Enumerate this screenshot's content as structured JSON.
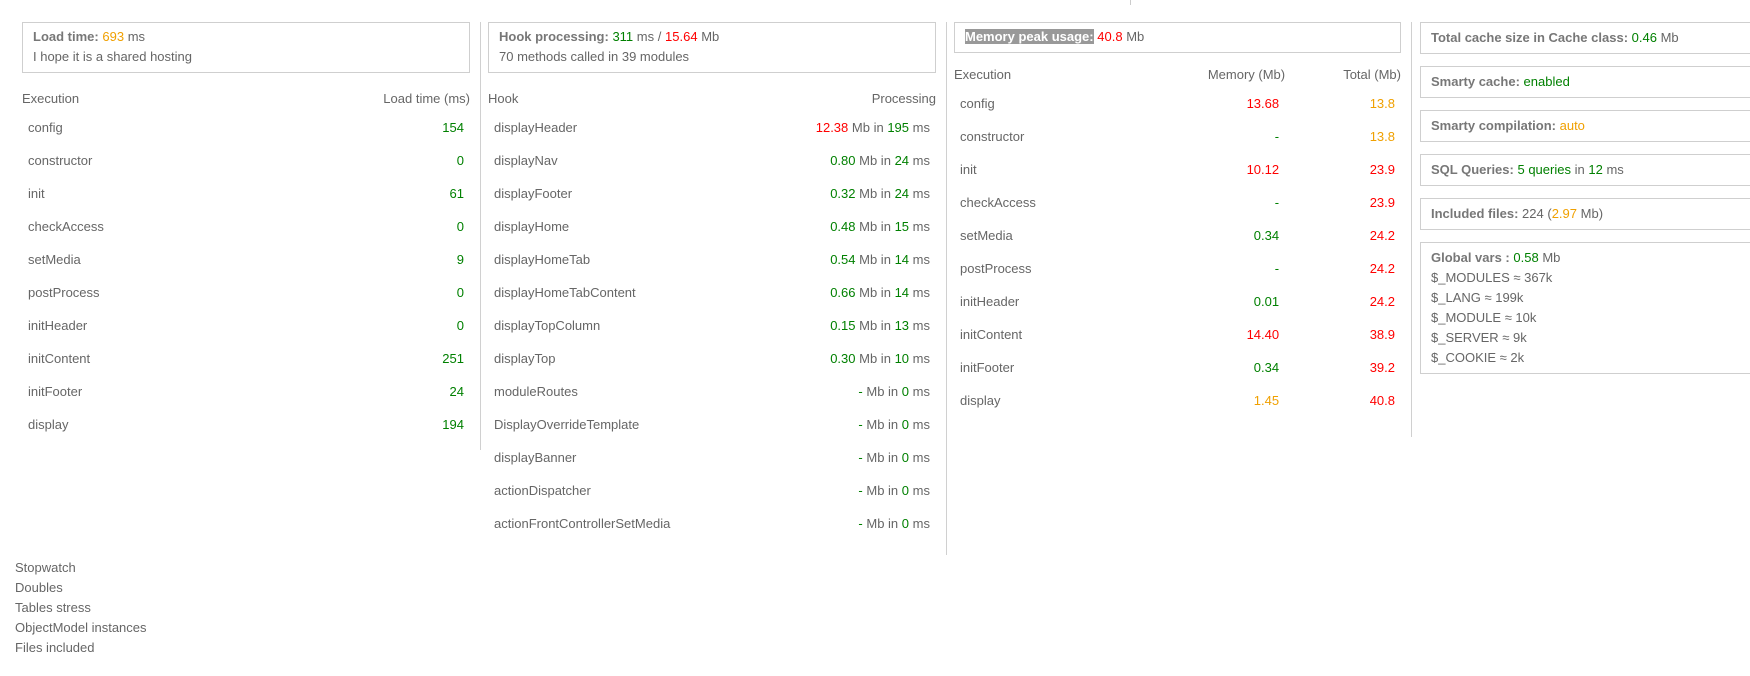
{
  "load": {
    "label": "Load time",
    "value": "693",
    "unit": "ms",
    "comment": "I hope it is a shared hosting",
    "table": {
      "headers": [
        "Execution",
        "Load time (ms)"
      ],
      "rows": [
        {
          "name": "config",
          "value": "154"
        },
        {
          "name": "constructor",
          "value": "0"
        },
        {
          "name": "init",
          "value": "61"
        },
        {
          "name": "checkAccess",
          "value": "0"
        },
        {
          "name": "setMedia",
          "value": "9"
        },
        {
          "name": "postProcess",
          "value": "0"
        },
        {
          "name": "initHeader",
          "value": "0"
        },
        {
          "name": "initContent",
          "value": "251"
        },
        {
          "name": "initFooter",
          "value": "24"
        },
        {
          "name": "display",
          "value": "194"
        }
      ]
    }
  },
  "hooks": {
    "label": "Hook processing",
    "time": "311",
    "time_unit": "ms",
    "sep": "/",
    "mem": "15.64",
    "mem_unit": "Mb",
    "summary": "70 methods called in 39 modules",
    "table": {
      "headers": [
        "Hook",
        "Processing"
      ],
      "mb_label": "Mb in",
      "ms_label": "ms",
      "rows": [
        {
          "name": "displayHeader",
          "mb": "12.38",
          "mb_color": "r",
          "ms": "195"
        },
        {
          "name": "displayNav",
          "mb": "0.80",
          "mb_color": "g",
          "ms": "24"
        },
        {
          "name": "displayFooter",
          "mb": "0.32",
          "mb_color": "g",
          "ms": "24"
        },
        {
          "name": "displayHome",
          "mb": "0.48",
          "mb_color": "g",
          "ms": "15"
        },
        {
          "name": "displayHomeTab",
          "mb": "0.54",
          "mb_color": "g",
          "ms": "14"
        },
        {
          "name": "displayHomeTabContent",
          "mb": "0.66",
          "mb_color": "g",
          "ms": "14"
        },
        {
          "name": "displayTopColumn",
          "mb": "0.15",
          "mb_color": "g",
          "ms": "13"
        },
        {
          "name": "displayTop",
          "mb": "0.30",
          "mb_color": "g",
          "ms": "10"
        },
        {
          "name": "moduleRoutes",
          "mb": "-",
          "mb_color": "g",
          "ms": "0"
        },
        {
          "name": "DisplayOverrideTemplate",
          "mb": "-",
          "mb_color": "g",
          "ms": "0"
        },
        {
          "name": "displayBanner",
          "mb": "-",
          "mb_color": "g",
          "ms": "0"
        },
        {
          "name": "actionDispatcher",
          "mb": "-",
          "mb_color": "g",
          "ms": "0"
        },
        {
          "name": "actionFrontControllerSetMedia",
          "mb": "-",
          "mb_color": "g",
          "ms": "0"
        }
      ]
    }
  },
  "memory": {
    "label": "Memory peak usage",
    "value": "40.8",
    "unit": "Mb",
    "table": {
      "headers": [
        "Execution",
        "Memory (Mb)",
        "Total (Mb)"
      ],
      "rows": [
        {
          "name": "config",
          "mem": "13.68",
          "mem_color": "r",
          "total": "13.8",
          "total_color": "o"
        },
        {
          "name": "constructor",
          "mem": "-",
          "mem_color": "g",
          "total": "13.8",
          "total_color": "o"
        },
        {
          "name": "init",
          "mem": "10.12",
          "mem_color": "r",
          "total": "23.9",
          "total_color": "r"
        },
        {
          "name": "checkAccess",
          "mem": "-",
          "mem_color": "g",
          "total": "23.9",
          "total_color": "r"
        },
        {
          "name": "setMedia",
          "mem": "0.34",
          "mem_color": "g",
          "total": "24.2",
          "total_color": "r"
        },
        {
          "name": "postProcess",
          "mem": "-",
          "mem_color": "g",
          "total": "24.2",
          "total_color": "r"
        },
        {
          "name": "initHeader",
          "mem": "0.01",
          "mem_color": "g",
          "total": "24.2",
          "total_color": "r"
        },
        {
          "name": "initContent",
          "mem": "14.40",
          "mem_color": "r",
          "total": "38.9",
          "total_color": "r"
        },
        {
          "name": "initFooter",
          "mem": "0.34",
          "mem_color": "g",
          "total": "39.2",
          "total_color": "r"
        },
        {
          "name": "display",
          "mem": "1.45",
          "mem_color": "o",
          "total": "40.8",
          "total_color": "r"
        }
      ]
    }
  },
  "stats": {
    "cache_label": "Total cache size in Cache class",
    "cache_value": "0.46",
    "cache_unit": "Mb",
    "smarty_cache_label": "Smarty cache",
    "smarty_cache_value": "enabled",
    "smarty_comp_label": "Smarty compilation",
    "smarty_comp_value": "auto",
    "sql_label": "SQL Queries",
    "sql_value": "5 queries",
    "sql_in": "in",
    "sql_ms": "12",
    "sql_unit": "ms",
    "files_label": "Included files",
    "files_count": "224",
    "files_mb": "2.97",
    "files_unit": "Mb",
    "globals_label": "Global vars",
    "globals_value": "0.58",
    "globals_unit": "Mb",
    "globals": [
      "$_MODULES ≈ 367k",
      "$_LANG ≈ 199k",
      "$_MODULE ≈ 10k",
      "$_SERVER ≈ 9k",
      "$_COOKIE ≈ 2k"
    ]
  },
  "links": [
    "Stopwatch",
    "Doubles",
    "Tables stress",
    "ObjectModel instances",
    "Files included"
  ],
  "colors": {
    "green": "#008000",
    "orange": "#f0a000",
    "red": "#ff0000",
    "text": "#555555",
    "border": "#cfcfcf"
  }
}
